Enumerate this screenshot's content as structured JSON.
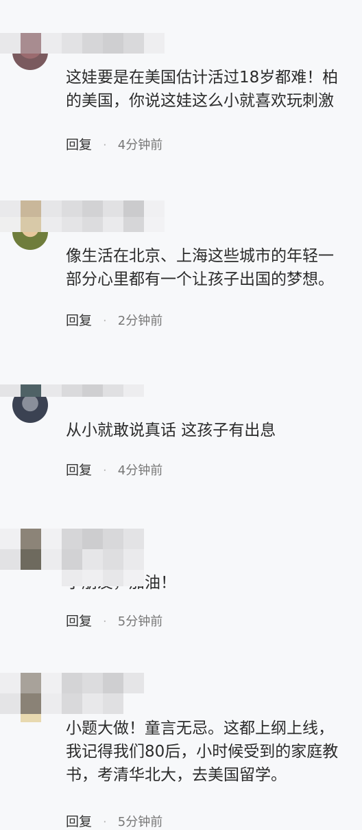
{
  "comments": [
    {
      "lines": [
        "这娃要是在美国估计活过18岁都难！柏",
        "的美国，你说这娃这么小就喜欢玩刺激"
      ],
      "reply_label": "回复",
      "separator": "·",
      "time": "4分钟前"
    },
    {
      "lines": [
        "像生活在北京、上海这些城市的年轻一",
        "部分心里都有一个让孩子出国的梦想。"
      ],
      "reply_label": "回复",
      "separator": "·",
      "time": "2分钟前"
    },
    {
      "lines": [
        "从小就敢说真话 这孩子有出息"
      ],
      "reply_label": "回复",
      "separator": "·",
      "time": "4分钟前"
    },
    {
      "lines": [
        "小朋友，加油！"
      ],
      "reply_label": "回复",
      "separator": "·",
      "time": "5分钟前"
    },
    {
      "lines": [
        "小题大做！童言无忌。这都上纲上线，",
        "我记得我们80后，小时候受到的家庭教",
        "书，考清华北大，去美国留学。"
      ],
      "reply_label": "回复",
      "separator": "·",
      "time": "5分钟前"
    }
  ]
}
